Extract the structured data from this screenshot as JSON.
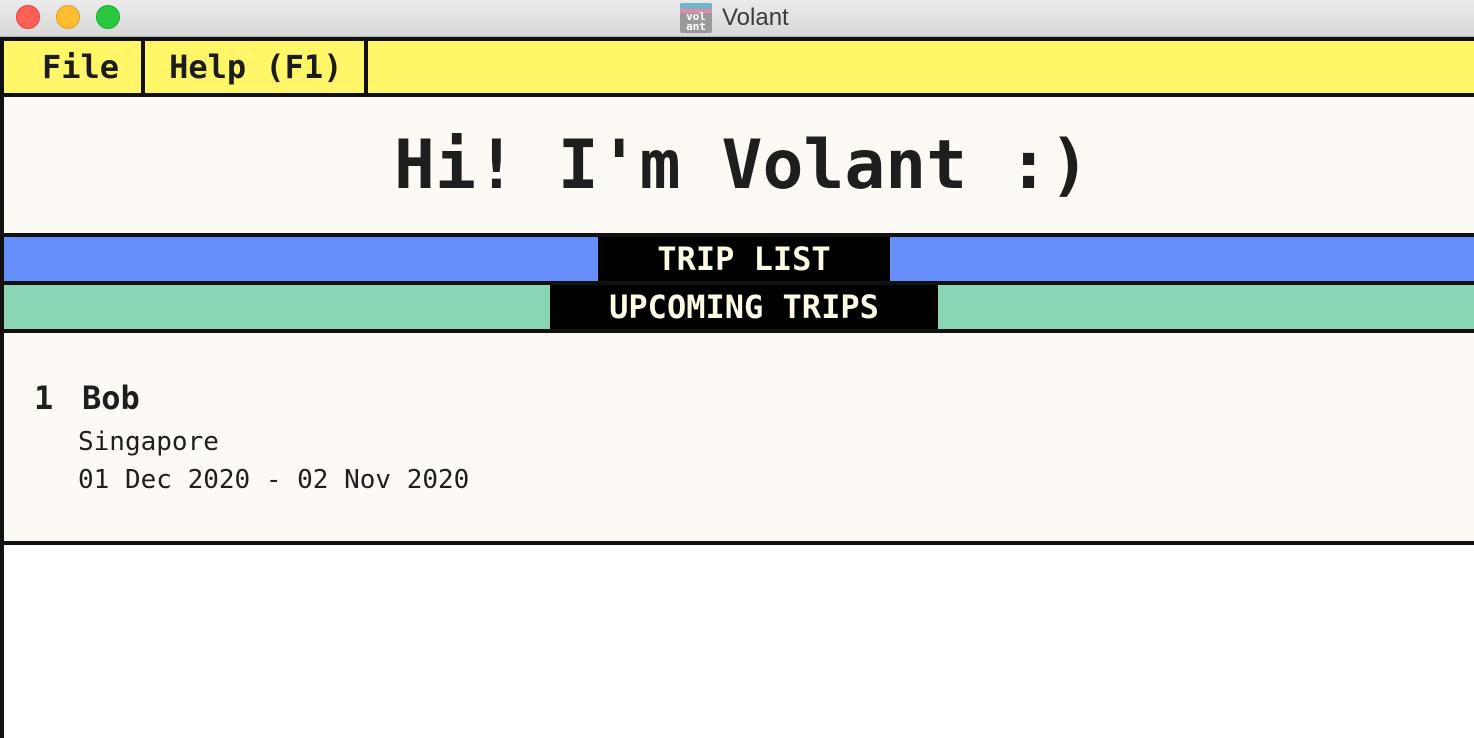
{
  "window": {
    "title": "Volant",
    "icon": "volant-app-icon",
    "icon_text": "vol ant"
  },
  "menubar": {
    "items": [
      {
        "label": "File"
      },
      {
        "label": "Help (F1)"
      }
    ]
  },
  "greeting": "Hi! I'm Volant :)",
  "sections": {
    "trip_list_label": "TRIP LIST",
    "upcoming_label": "UPCOMING TRIPS"
  },
  "trips": [
    {
      "index": "1",
      "name": "Bob",
      "location": "Singapore",
      "dates": "01 Dec 2020 - 02 Nov 2020"
    }
  ],
  "colors": {
    "menubar_bg": "#fff767",
    "trip_list_band": "#668ffc",
    "upcoming_band": "#8ad5b4",
    "panel_bg": "#fdfaf5",
    "label_bg": "#000000"
  }
}
